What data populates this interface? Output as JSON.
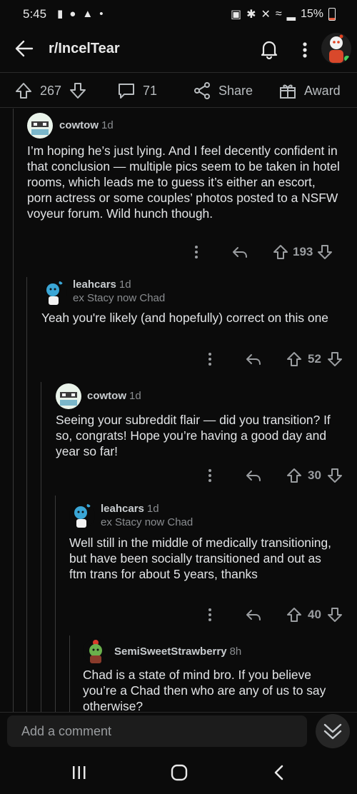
{
  "status_bar": {
    "time": "5:45",
    "battery": "15%"
  },
  "header": {
    "title": "r/IncelTear"
  },
  "post_actions": {
    "upvotes": "267",
    "comments": "71",
    "share_label": "Share",
    "award_label": "Award"
  },
  "comments": [
    {
      "user": "cowtow",
      "time": "1d",
      "flair": "",
      "body": "I’m hoping he’s just lying. And I feel decently confident in that conclusion — multiple pics seem to be taken in hotel rooms, which leads me to guess it’s either an escort, porn actress or some couples’ photos posted to a NSFW voyeur forum. Wild hunch though.",
      "votes": "193"
    },
    {
      "user": "leahcars",
      "time": "1d",
      "flair": "ex Stacy now Chad",
      "body": "Yeah you're likely (and hopefully) correct on this one",
      "votes": "52"
    },
    {
      "user": "cowtow",
      "time": "1d",
      "flair": "",
      "body": "Seeing your subreddit flair — did you transition? If so, congrats! Hope you’re having a good day and year so far!",
      "votes": "30"
    },
    {
      "user": "leahcars",
      "time": "1d",
      "flair": "ex Stacy now Chad",
      "body": "Well still in the middle of medically transitioning, but have been socially transitioned and out as ftm trans for about 5 years,  thanks",
      "votes": "40"
    },
    {
      "user": "SemiSweetStrawberry",
      "time": "8h",
      "flair": "",
      "body": "Chad is a state of mind bro. If you believe you’re a Chad then who are any of us to say otherwise?",
      "votes": ""
    }
  ],
  "composer": {
    "placeholder": "Add a comment"
  },
  "colors": {
    "background": "#0b0b0b",
    "text": "#e3e5e7",
    "muted": "#8a8d90",
    "thread_line": "#3a3a3a"
  }
}
